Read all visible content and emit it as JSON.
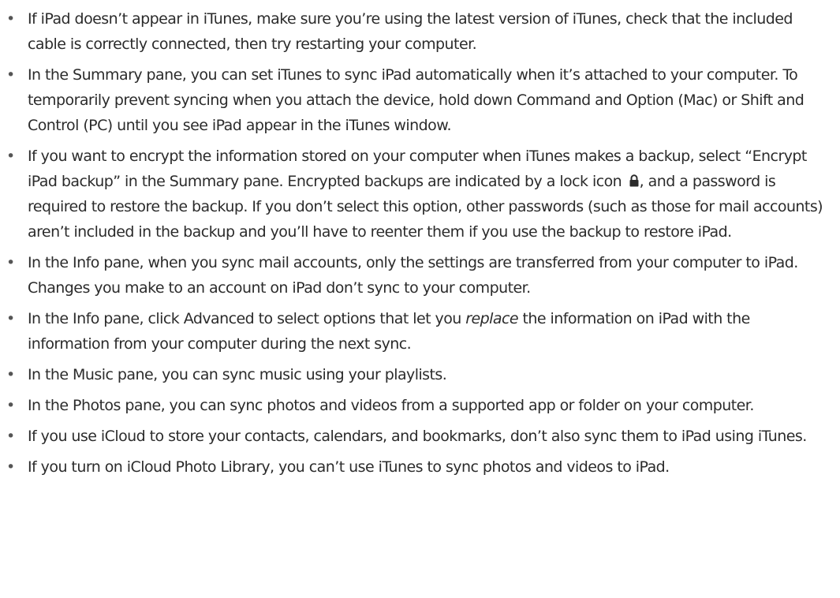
{
  "bullet_glyph": "•",
  "icons": {
    "lock": "lock-icon"
  },
  "tips": [
    {
      "text": "If iPad doesn’t appear in iTunes, make sure you’re using the latest version of iTunes, check that the included cable is correctly connected, then try restarting your computer."
    },
    {
      "text": "In the Summary pane, you can set iTunes to sync iPad automatically when it’s attached to your computer. To temporarily prevent syncing when you attach the device, hold down Command and Option (Mac) or Shift and Control (PC) until you see iPad appear in the iTunes window."
    },
    {
      "before_icon": "If you want to encrypt the information stored on your computer when iTunes makes a backup, select “Encrypt iPad backup” in the Summary pane. Encrypted backups are indicated by a lock icon",
      "after_icon": ", and a password is required to restore the backup. If you don’t select this option, other passwords (such as those for mail accounts) aren’t included in the backup and you’ll have to reenter them if you use the backup to restore iPad."
    },
    {
      "text": "In the Info pane, when you sync mail accounts, only the settings are transferred from your computer to iPad. Changes you make to an account on iPad don’t sync to your computer."
    },
    {
      "before_em": "In the Info pane, click Advanced to select options that let you ",
      "em": "replace",
      "after_em": " the information on iPad with the information from your computer during the next sync."
    },
    {
      "text": "In the Music pane, you can sync music using your playlists."
    },
    {
      "text": "In the Photos pane, you can sync photos and videos from a supported app or folder on your computer."
    },
    {
      "text": "If you use iCloud to store your contacts, calendars, and bookmarks, don’t also sync them to iPad using iTunes."
    },
    {
      "text": "If you turn on iCloud Photo Library, you can’t use iTunes to sync photos and videos to iPad."
    }
  ]
}
